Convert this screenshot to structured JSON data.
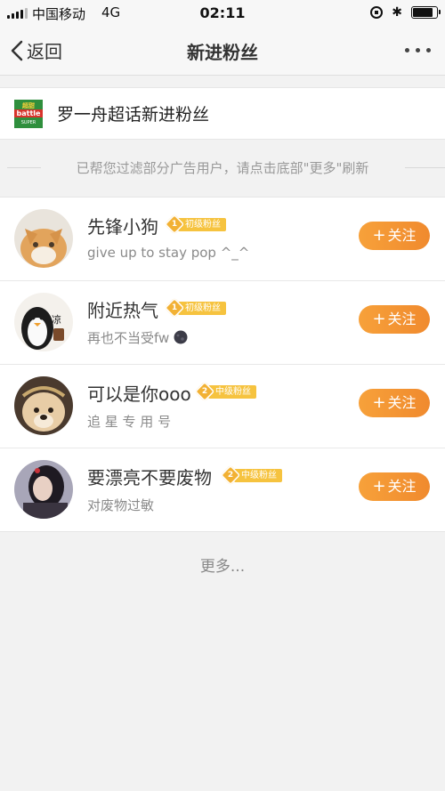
{
  "status_bar": {
    "carrier": "中国移动",
    "network": "4G",
    "time": "02:11"
  },
  "nav": {
    "back_label": "返回",
    "title": "新进粉丝"
  },
  "topic": {
    "thumb_lines": [
      "超甜",
      "battle",
      "SUPER"
    ],
    "label": "罗一舟超话新进粉丝"
  },
  "notice": "已帮您过滤部分广告用户，请点击底部\"更多\"刷新",
  "fans": [
    {
      "name": "先锋小狗",
      "level_num": "1",
      "level_label": "初级粉丝",
      "bio": "give up to stay pop ^_^",
      "follow_label": "关注"
    },
    {
      "name": "附近热气",
      "level_num": "1",
      "level_label": "初级粉丝",
      "bio": "再也不当受fw",
      "follow_label": "关注"
    },
    {
      "name": "可以是你ooo",
      "level_num": "2",
      "level_label": "中级粉丝",
      "bio": "追 星 专 用 号",
      "follow_label": "关注"
    },
    {
      "name": "要漂亮不要废物",
      "level_num": "2",
      "level_label": "中级粉丝",
      "bio": "对废物过敏",
      "follow_label": "关注"
    }
  ],
  "more_label": "更多...",
  "colors": {
    "accent": "#f29032",
    "badge": "#f6c33f"
  }
}
